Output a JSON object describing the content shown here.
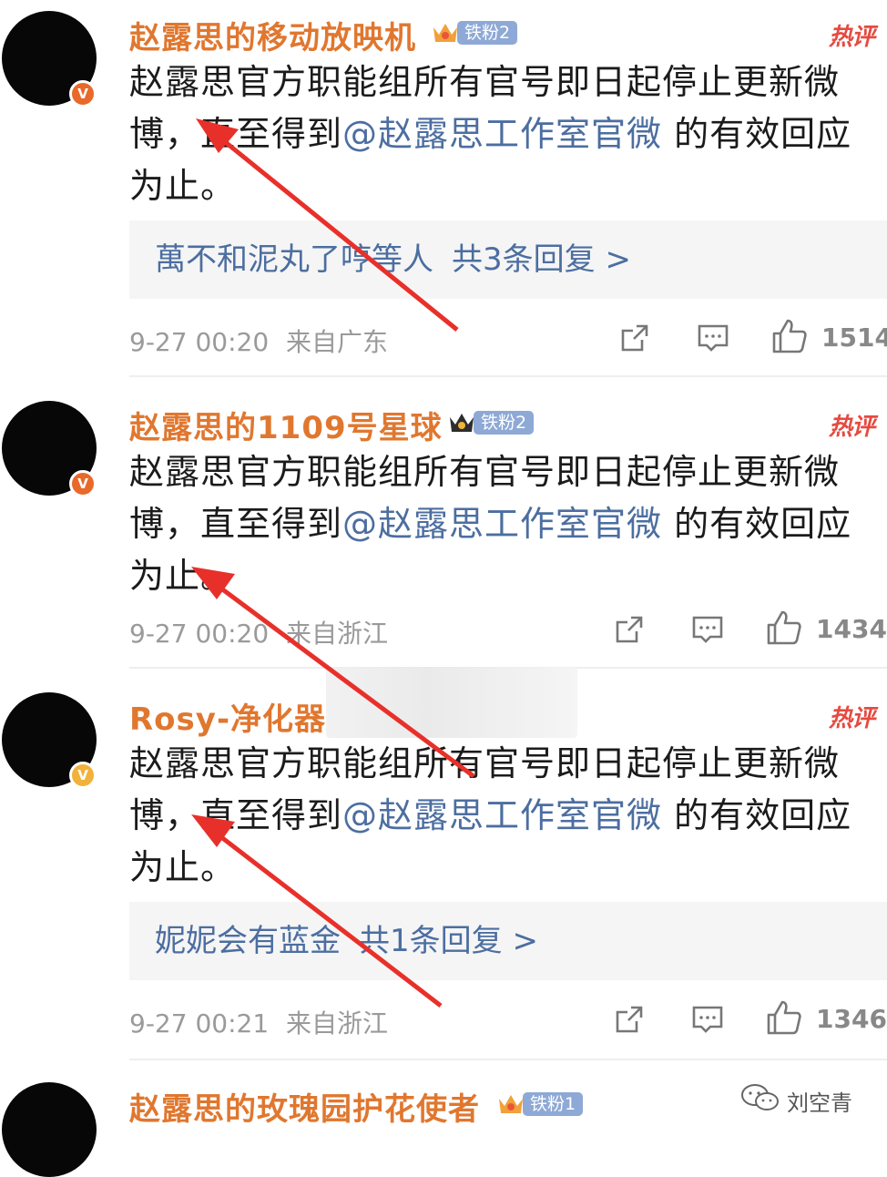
{
  "comments": [
    {
      "username": "赵露思的移动放映机",
      "fan_badge": "铁粉2",
      "hot_label": "热评",
      "body_prefix": "赵露思官方职能组所有官号即日起停止更新微博，直至得到",
      "mention": "@赵露思工作室官微",
      "body_suffix": " 的有效回应为止。",
      "reply_preview": "萬不和泥丸了哼等人",
      "reply_count": "共3条回复 >",
      "time": "9-27 00:20",
      "location": "来自广东",
      "likes": "1514"
    },
    {
      "username": "赵露思的1109号星球",
      "fan_badge": "铁粉2",
      "hot_label": "热评",
      "body_prefix": "赵露思官方职能组所有官号即日起停止更新微博，直至得到",
      "mention": "@赵露思工作室官微",
      "body_suffix": " 的有效回应为止。",
      "time": "9-27 00:20",
      "location": "来自浙江",
      "likes": "1434"
    },
    {
      "username": "Rosy-净化器",
      "hot_label": "热评",
      "body_prefix": "赵露思官方职能组所有官号即日起停止更新微博，直至得到",
      "mention": "@赵露思工作室官微",
      "body_suffix": " 的有效回应为止。",
      "reply_preview": "妮妮会有蓝金",
      "reply_count": "共1条回复 >",
      "time": "9-27 00:21",
      "location": "来自浙江",
      "likes": "1346"
    },
    {
      "username": "赵露思的玫瑰园护花使者",
      "fan_badge": "铁粉1"
    }
  ],
  "watermark": {
    "text": "刘空青",
    "icon": "wechat-icon"
  },
  "colors": {
    "username": "#e0772f",
    "mention": "#4c6ea0",
    "hot": "#e64a40",
    "arrow": "#e8302a"
  }
}
